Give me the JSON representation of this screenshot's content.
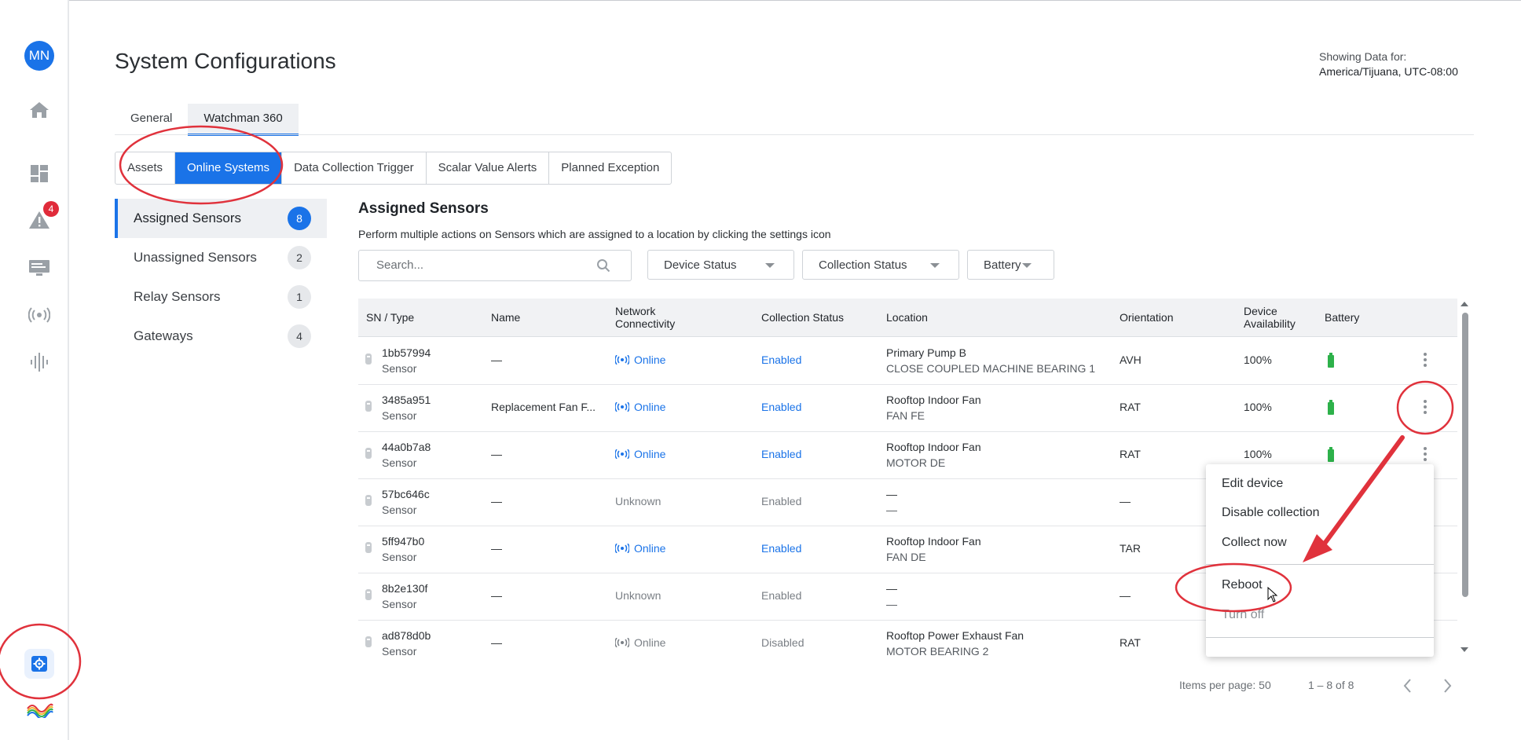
{
  "app": {
    "avatar_initials": "MN",
    "alerts_badge": "4",
    "accent_color": "#1a73e8",
    "rail_icons": [
      "home-icon",
      "dashboard-icon",
      "alert-icon",
      "monitor-icon",
      "wireless-icon",
      "waveform-icon",
      "settings-icon"
    ]
  },
  "header": {
    "title": "System Configurations",
    "showing_label": "Showing Data for:",
    "timezone": "America/Tijuana, UTC-08:00"
  },
  "tabs": [
    {
      "label": "General",
      "active": false
    },
    {
      "label": "Watchman 360",
      "active": true
    }
  ],
  "subtabs": [
    {
      "label": "Assets",
      "active": false
    },
    {
      "label": "Online Systems",
      "active": true
    },
    {
      "label": "Data Collection Trigger",
      "active": false
    },
    {
      "label": "Scalar Value Alerts",
      "active": false
    },
    {
      "label": "Planned Exception",
      "active": false
    }
  ],
  "sidebar": {
    "items": [
      {
        "label": "Assigned Sensors",
        "count": "8",
        "active": true
      },
      {
        "label": "Unassigned Sensors",
        "count": "2",
        "active": false
      },
      {
        "label": "Relay Sensors",
        "count": "1",
        "active": false
      },
      {
        "label": "Gateways",
        "count": "4",
        "active": false
      }
    ]
  },
  "main": {
    "title": "Assigned Sensors",
    "description": "Perform multiple actions on Sensors which are assigned to a location by clicking the settings icon",
    "search_placeholder": "Search...",
    "filters": {
      "device_status": "Device Status",
      "collection_status": "Collection Status",
      "battery": "Battery"
    }
  },
  "table": {
    "headers": {
      "sn_type": "SN / Type",
      "name": "Name",
      "network_1": "Network",
      "network_2": "Connectivity",
      "collection_status": "Collection Status",
      "location": "Location",
      "orientation": "Orientation",
      "availability_1": "Device",
      "availability_2": "Availability",
      "battery": "Battery"
    },
    "rows": [
      {
        "sn": "1bb57994",
        "type": "Sensor",
        "name": "—",
        "network": "Online",
        "collection": "Enabled",
        "loc1": "Primary Pump B",
        "loc2": "CLOSE COUPLED MACHINE BEARING 1",
        "orientation": "AVH",
        "availability": "100%"
      },
      {
        "sn": "3485a951",
        "type": "Sensor",
        "name": "Replacement Fan F...",
        "network": "Online",
        "collection": "Enabled",
        "loc1": "Rooftop Indoor Fan",
        "loc2": "FAN FE",
        "orientation": "RAT",
        "availability": "100%"
      },
      {
        "sn": "44a0b7a8",
        "type": "Sensor",
        "name": "—",
        "network": "Online",
        "collection": "Enabled",
        "loc1": "Rooftop Indoor Fan",
        "loc2": "MOTOR DE",
        "orientation": "RAT",
        "availability": "100%"
      },
      {
        "sn": "57bc646c",
        "type": "Sensor",
        "name": "—",
        "network": "Unknown",
        "collection": "Enabled",
        "loc1": "—",
        "loc2": "—",
        "orientation": "—",
        "availability": ""
      },
      {
        "sn": "5ff947b0",
        "type": "Sensor",
        "name": "—",
        "network": "Online",
        "collection": "Enabled",
        "loc1": "Rooftop Indoor Fan",
        "loc2": "FAN DE",
        "orientation": "TAR",
        "availability": ""
      },
      {
        "sn": "8b2e130f",
        "type": "Sensor",
        "name": "—",
        "network": "Unknown",
        "collection": "Enabled",
        "loc1": "—",
        "loc2": "—",
        "orientation": "—",
        "availability": ""
      },
      {
        "sn": "ad878d0b",
        "type": "Sensor",
        "name": "—",
        "network": "Online",
        "collection": "Disabled",
        "loc1": "Rooftop Power Exhaust Fan",
        "loc2": "MOTOR BEARING 2",
        "orientation": "RAT",
        "availability": ""
      }
    ]
  },
  "pagination": {
    "items_per_page": "Items per page: 50",
    "range": "1 – 8 of 8"
  },
  "context_menu": {
    "items": [
      "Edit device",
      "Disable collection",
      "Collect now",
      "Reboot",
      "Turn off"
    ]
  },
  "colors": {
    "online": "#1a73e8",
    "battery": "#2db14a",
    "annotation": "#e0323c"
  }
}
